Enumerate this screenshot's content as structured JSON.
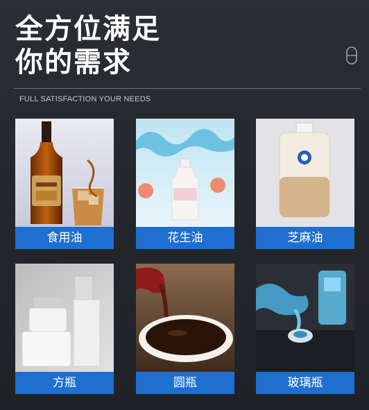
{
  "header": {
    "title_line1": "全方位满足",
    "title_line2": "你的需求",
    "subtitle": "FULL SATISFACTION YOUR NEEDS"
  },
  "colors": {
    "background": "#25292d",
    "label_bar": "#1e6fd0",
    "text": "#ffffff"
  },
  "products": [
    {
      "label": "食用油",
      "image": "whisky-bottle-with-ice-glass"
    },
    {
      "label": "花生油",
      "image": "bottle-with-water-splash-and-peaches"
    },
    {
      "label": "芝麻油",
      "image": "square-milk-tea-bottle"
    },
    {
      "label": "方瓶",
      "image": "cosmetic-jar-and-bottle"
    },
    {
      "label": "圆瓶",
      "image": "soy-sauce-pouring-into-bowl"
    },
    {
      "label": "玻璃瓶",
      "image": "washer-fluid-filling-car-reservoir"
    }
  ]
}
